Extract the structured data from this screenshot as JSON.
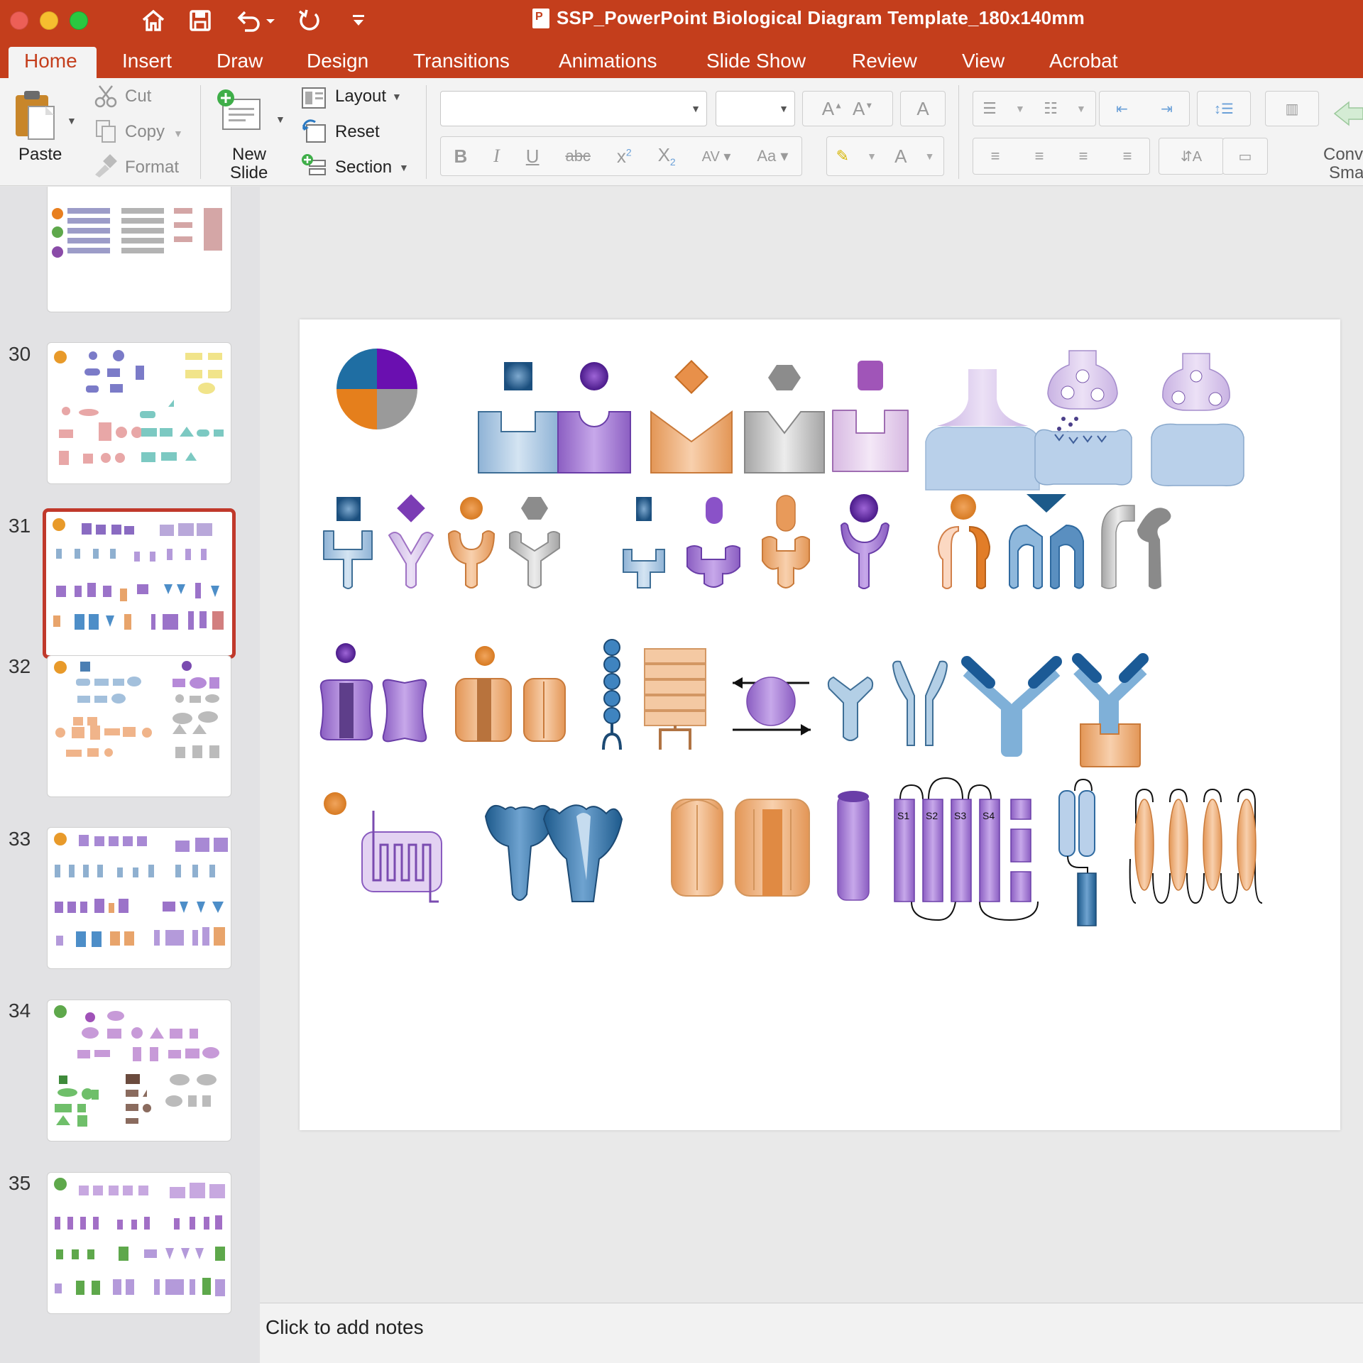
{
  "window": {
    "title": "SSP_PowerPoint Biological Diagram Template_180x140mm"
  },
  "tabs": [
    "Home",
    "Insert",
    "Draw",
    "Design",
    "Transitions",
    "Animations",
    "Slide Show",
    "Review",
    "View",
    "Acrobat"
  ],
  "active_tab": "Home",
  "ribbon": {
    "paste": "Paste",
    "cut": "Cut",
    "copy": "Copy",
    "format": "Format",
    "new_slide_line1": "New",
    "new_slide_line2": "Slide",
    "layout": "Layout",
    "reset": "Reset",
    "section": "Section",
    "convert_line1": "Conv",
    "convert_line2": "Sma"
  },
  "thumbnails": {
    "numbers": [
      "30",
      "31",
      "32",
      "33",
      "34",
      "35"
    ],
    "selected": "31"
  },
  "slide_labels": {
    "s1": "S1",
    "s2": "S2",
    "s3": "S3",
    "s4": "S4"
  },
  "notes": {
    "placeholder": "Click to add notes"
  },
  "colors": {
    "accent": "#c43e1c",
    "blue_shape": "#a9c4dd",
    "purple_shape": "#9b73c9",
    "orange_shape": "#e8a46b",
    "gray_shape": "#b9b9b9"
  }
}
